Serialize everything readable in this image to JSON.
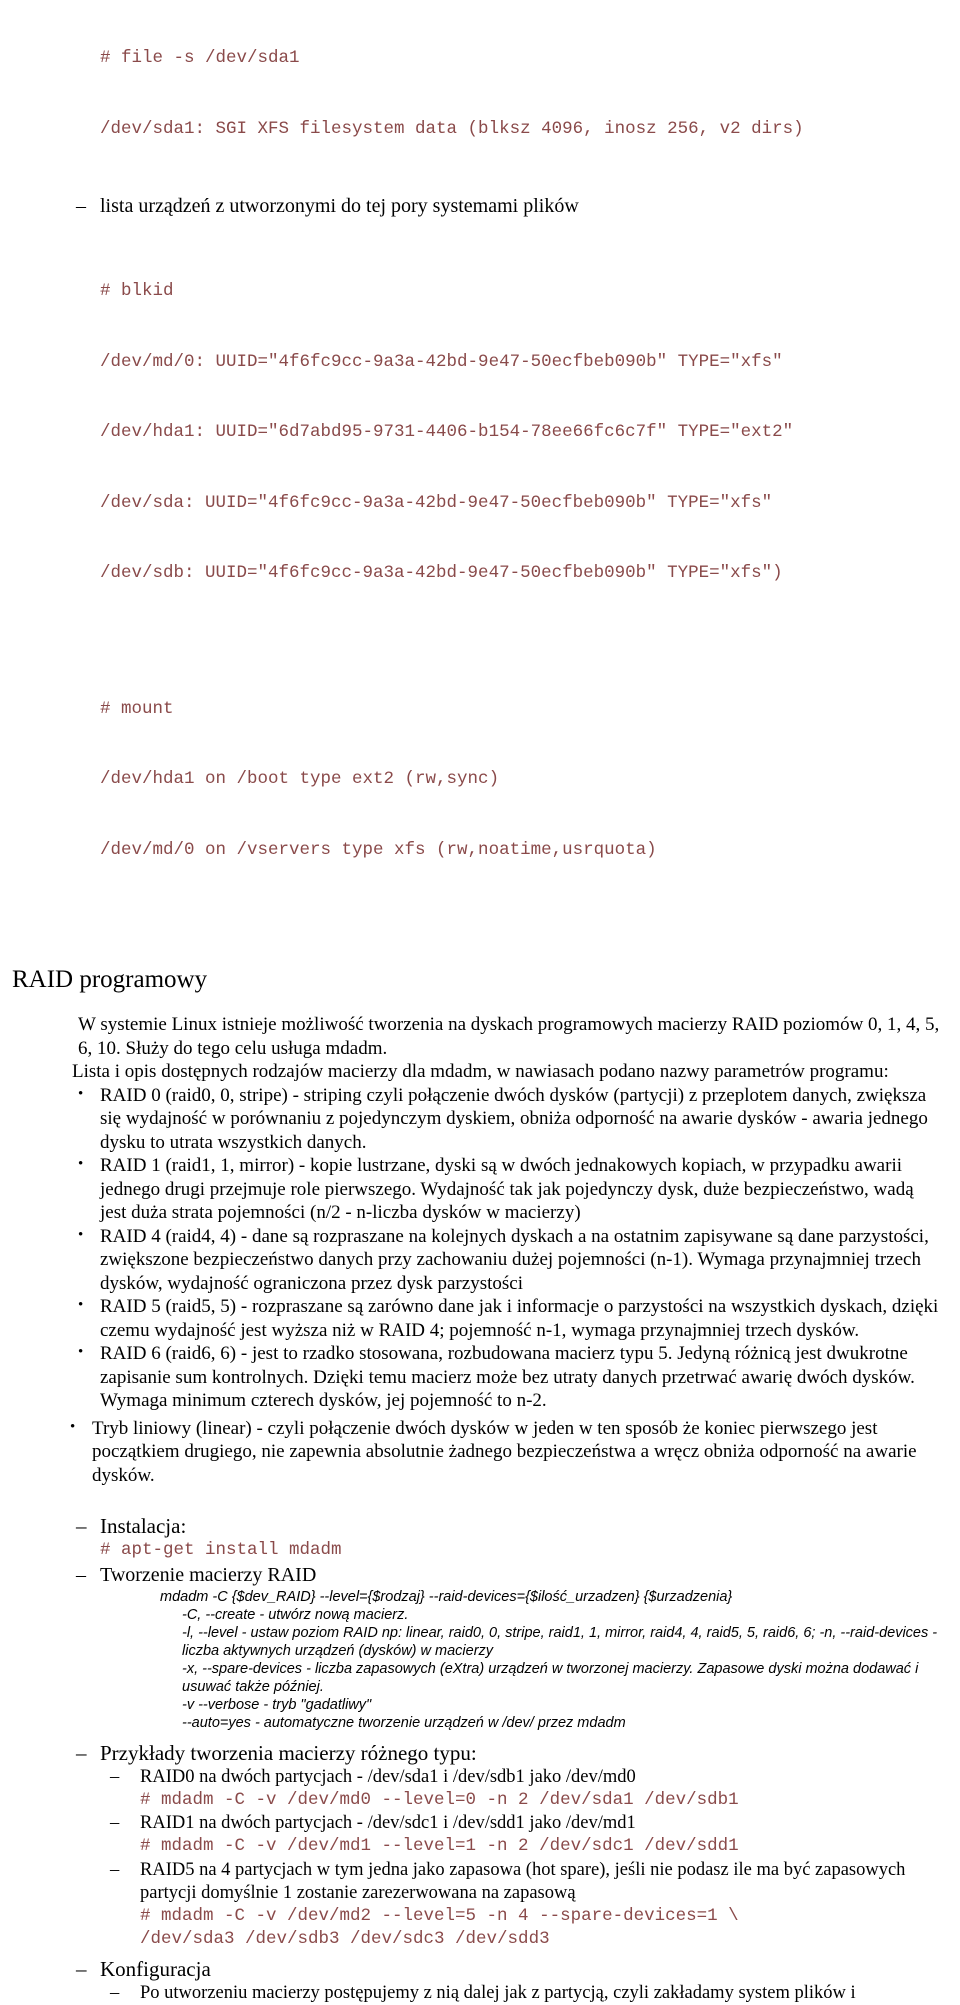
{
  "document": {
    "language": "pl",
    "colors": {
      "code_text": "#8a4a4a",
      "body_text": "#000000",
      "background": "#ffffff"
    }
  },
  "terminal_file": {
    "command": "# file -s /dev/sda1",
    "output": "/dev/sda1: SGI XFS filesystem data (blksz 4096, inosz 256, v2 dirs)"
  },
  "note_devices": {
    "marker": "–",
    "text": "lista urządzeń z utworzonymi do tej pory systemami plików"
  },
  "terminal_blkid": {
    "command": "# blkid",
    "lines": [
      "/dev/md/0: UUID=\"4f6fc9cc-9a3a-42bd-9e47-50ecfbeb090b\" TYPE=\"xfs\"",
      "/dev/hda1: UUID=\"6d7abd95-9731-4406-b154-78ee66fc6c7f\" TYPE=\"ext2\"",
      "/dev/sda: UUID=\"4f6fc9cc-9a3a-42bd-9e47-50ecfbeb090b\" TYPE=\"xfs\"",
      "/dev/sdb: UUID=\"4f6fc9cc-9a3a-42bd-9e47-50ecfbeb090b\" TYPE=\"xfs\")"
    ]
  },
  "terminal_mount": {
    "command": "# mount",
    "lines": [
      "/dev/hda1 on /boot type ext2 (rw,sync)",
      "/dev/md/0 on /vservers type xfs (rw,noatime,usrquota)"
    ]
  },
  "section_raid": {
    "heading": "RAID programowy",
    "intro": "W systemie Linux istnieje możliwość tworzenia na dyskach programowych macierzy RAID poziomów 0, 1, 4, 5, 6, 10. Służy do tego celu usługa mdadm.",
    "list_lead": "Lista i opis dostępnych rodzajów macierzy dla mdadm, w nawiasach podano nazwy parametrów programu:",
    "bullet_marker": "•",
    "levels": [
      {
        "name": "raid0",
        "text": "RAID 0 (raid0, 0, stripe) - striping czyli połączenie dwóch dysków (partycji) z przeplotem danych, zwiększa się wydajność w porównaniu z pojedynczym dyskiem, obniża odporność na awarie dysków - awaria jednego dysku to utrata wszystkich danych."
      },
      {
        "name": "raid1",
        "text": "RAID 1 (raid1, 1, mirror) - kopie lustrzane, dyski są w dwóch jednakowych kopiach, w przypadku awarii jednego drugi przejmuje role pierwszego. Wydajność tak jak pojedynczy dysk, duże bezpieczeństwo, wadą jest duża strata pojemności (n/2 - n-liczba dysków w macierzy)"
      },
      {
        "name": "raid4",
        "text": "RAID 4 (raid4, 4) - dane są rozpraszane na kolejnych dyskach a na ostatnim zapisywane są dane parzystości, zwiększone bezpieczeństwo danych przy zachowaniu dużej pojemności (n-1). Wymaga przynajmniej trzech dysków, wydajność ograniczona przez dysk parzystości"
      },
      {
        "name": "raid5",
        "text": "RAID 5 (raid5, 5) - rozpraszane są zarówno dane jak i informacje o parzystości na wszystkich dyskach, dzięki czemu wydajność jest wyższa niż w RAID 4; pojemność n-1, wymaga przynajmniej trzech dysków."
      },
      {
        "name": "raid6",
        "text": "RAID 6 (raid6, 6) - jest to rzadko stosowana, rozbudowana macierz typu 5. Jedyną różnicą jest dwukrotne zapisanie sum kontrolnych. Dzięki temu macierz może bez utraty danych przetrwać awarię dwóch dysków. Wymaga minimum czterech dysków, jej pojemność to n-2."
      },
      {
        "name": "linear",
        "text": "Tryb liniowy (linear) - czyli połączenie dwóch dysków w jeden w ten sposób że koniec pierwszego jest początkiem drugiego, nie zapewnia absolutnie żadnego bezpieczeństwa a wręcz obniża odporność na awarie dysków."
      }
    ]
  },
  "install": {
    "marker": "–",
    "label": "Instalacja:",
    "command": "# apt-get install mdadm"
  },
  "create_array": {
    "marker": "–",
    "label": "Tworzenie macierzy RAID",
    "syntax": "mdadm -C {$dev_RAID} --level={$rodzaj} --raid-devices={$ilość_urzadzen} {$urzadzenia}",
    "options": [
      "-C, --create - utwórz nową macierz.",
      "-l, --level - ustaw poziom RAID np: linear, raid0, 0, stripe, raid1, 1, mirror, raid4, 4, raid5, 5, raid6, 6; -n, --raid-devices - liczba aktywnych urządzeń (dysków) w macierzy",
      "-x, --spare-devices - liczba zapasowych (eXtra) urządzeń w tworzonej macierzy. Zapasowe dyski można dodawać i usuwać także później.",
      "-v --verbose - tryb \"gadatliwy\"",
      "--auto=yes - automatyczne tworzenie urządzeń w /dev/ przez mdadm"
    ]
  },
  "examples": {
    "marker": "–",
    "heading": "Przykłady tworzenia macierzy różnego typu:",
    "sub_marker": "–",
    "items": [
      {
        "desc": "RAID0 na dwóch partycjach - /dev/sda1 i /dev/sdb1 jako /dev/md0",
        "command": "# mdadm -C -v /dev/md0 --level=0 -n 2 /dev/sda1 /dev/sdb1"
      },
      {
        "desc": "RAID1 na dwóch partycjach - /dev/sdc1 i /dev/sdd1 jako /dev/md1",
        "command": "# mdadm -C -v /dev/md1 --level=1 -n 2 /dev/sdc1 /dev/sdd1"
      },
      {
        "desc": "RAID5 na 4 partycjach w tym jedna jako zapasowa (hot spare), jeśli nie podasz ile ma być zapasowych partycji domyślnie 1 zostanie zarezerwowana na zapasową",
        "command": "# mdadm -C -v /dev/md2 --level=5 -n 4 --spare-devices=1 \\\n/dev/sda3 /dev/sdb3 /dev/sdc3 /dev/sdd3"
      }
    ]
  },
  "configuration": {
    "marker": "–",
    "heading": "Konfiguracja",
    "sub_marker": "–",
    "item": "Po utworzeniu macierzy postępujemy z nią dalej jak z partycją, czyli zakładamy system plików i"
  }
}
